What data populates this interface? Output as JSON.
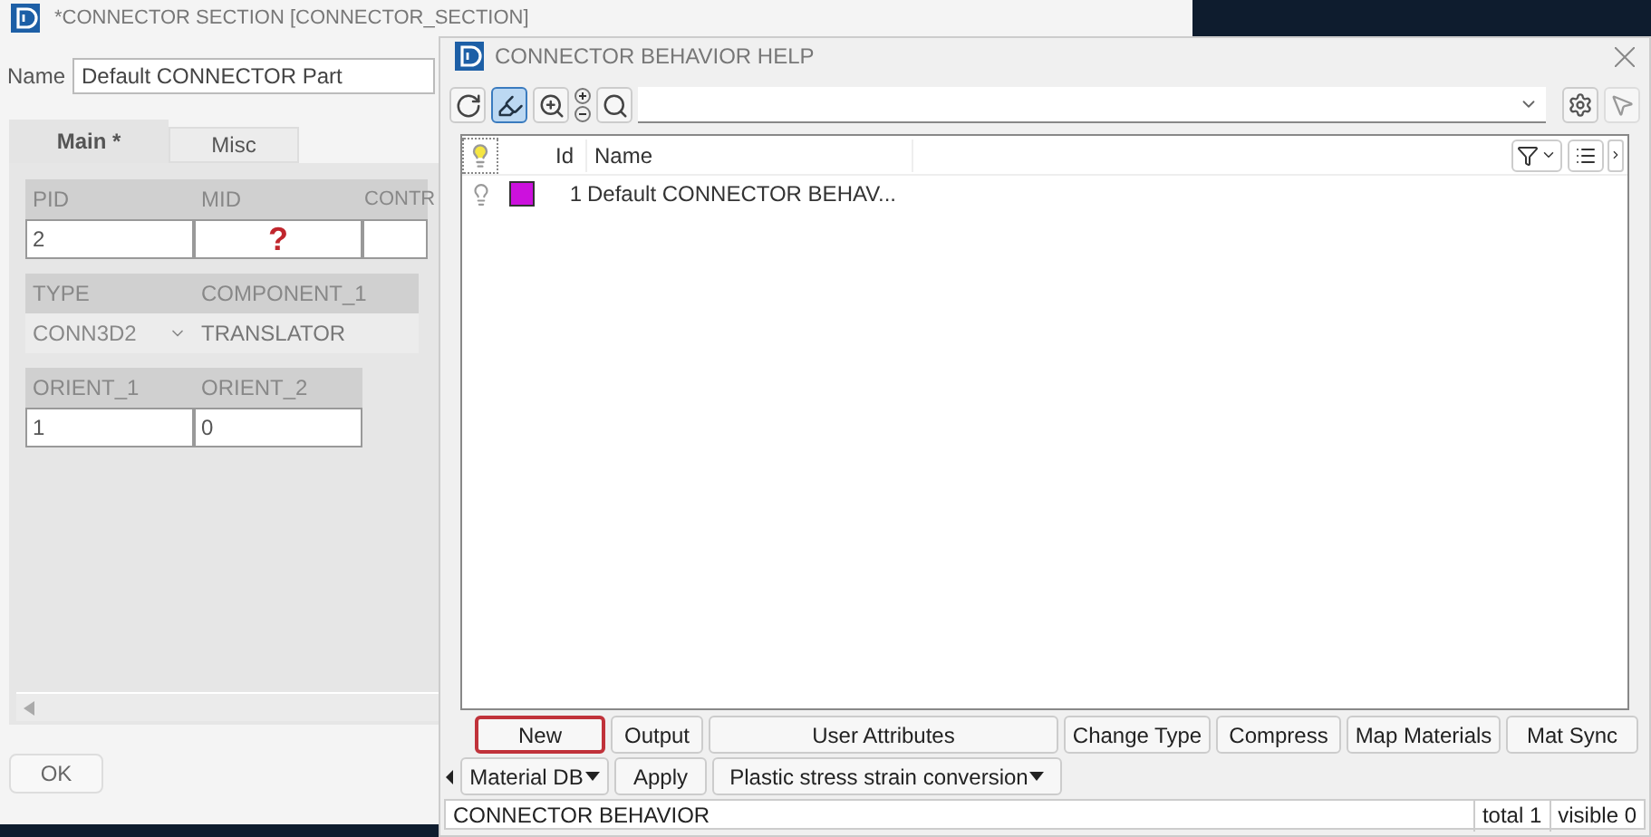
{
  "section_window": {
    "title": "*CONNECTOR SECTION [CONNECTOR_SECTION]",
    "name_label": "Name",
    "name_value": "Default CONNECTOR Part",
    "tabs": [
      {
        "label": "Main *",
        "selected": true
      },
      {
        "label": "Misc",
        "selected": false
      }
    ],
    "field_rows": [
      [
        {
          "label": "PID",
          "value": "2",
          "kind": "text"
        },
        {
          "label": "MID",
          "value": "?",
          "kind": "missing"
        },
        {
          "label": "CONTR",
          "kind": "text"
        }
      ],
      [
        {
          "label": "TYPE",
          "value": "CONN3D2",
          "kind": "combo"
        },
        {
          "label": "COMPONENT_1",
          "value": "TRANSLATOR",
          "kind": "readonly"
        }
      ],
      [
        {
          "label": "ORIENT_1",
          "value": "1",
          "kind": "text"
        },
        {
          "label": "ORIENT_2",
          "value": "0",
          "kind": "text"
        }
      ]
    ],
    "ok_button": "OK"
  },
  "help_dialog": {
    "title": "CONNECTOR BEHAVIOR HELP",
    "toolbar": [
      {
        "kind": "refresh",
        "selected": false
      },
      {
        "kind": "highlight",
        "selected": true
      },
      {
        "kind": "zoom",
        "selected": false
      },
      {
        "kind": "plusminus",
        "selected": false
      },
      {
        "kind": "search",
        "selected": false
      }
    ],
    "table": {
      "columns": [
        "Id",
        "Name"
      ],
      "header_lit": true,
      "rows": [
        {
          "lit": false,
          "color": "#cc11dd",
          "id": "1",
          "name": "Default CONNECTOR BEHAV..."
        }
      ]
    },
    "button_rows": [
      [
        {
          "label": "New",
          "focused": true,
          "dropdown": false
        },
        {
          "label": "Output",
          "focused": false,
          "dropdown": false
        },
        {
          "label": "User Attributes",
          "focused": false,
          "dropdown": false
        },
        {
          "label": "Change Type",
          "focused": false,
          "dropdown": false
        },
        {
          "label": "Compress",
          "focused": false,
          "dropdown": false
        },
        {
          "label": "Map Materials",
          "focused": false,
          "dropdown": false
        },
        {
          "label": "Mat Sync",
          "focused": false,
          "dropdown": false
        }
      ],
      [
        {
          "label": "Material DB",
          "focused": false,
          "dropdown": true
        },
        {
          "label": "Apply",
          "focused": false,
          "dropdown": false
        },
        {
          "label": "Plastic stress strain conversion",
          "focused": false,
          "dropdown": true
        }
      ]
    ],
    "status_bar": {
      "text": "CONNECTOR BEHAVIOR",
      "total": "total 1",
      "visible": "visible 0"
    }
  }
}
